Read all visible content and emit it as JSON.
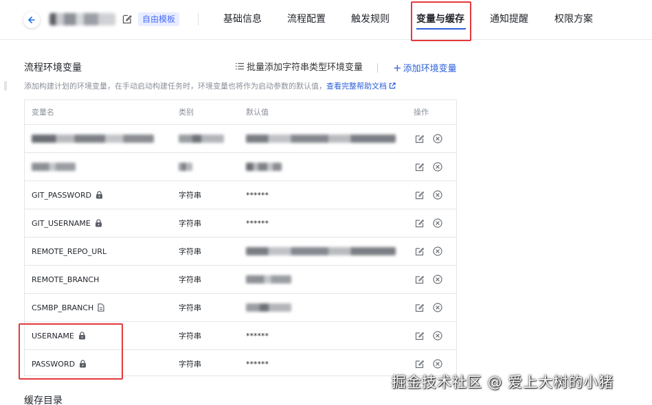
{
  "header": {
    "free_tag": "自由模板",
    "tabs": [
      "基础信息",
      "流程配置",
      "触发规则",
      "变量与缓存",
      "通知提醒",
      "权限方案"
    ],
    "active_tab": "变量与缓存"
  },
  "section": {
    "title": "流程环境变量",
    "batch_add": "批量添加字符串类型环境变量",
    "add_env": "添加环境变量",
    "desc": "添加构建计划的环境变量，在手动启动构建任务时，环境变量也将作为启动参数的默认值，",
    "help_link": "查看完整帮助文档"
  },
  "table": {
    "columns": [
      "变量名",
      "类别",
      "默认值",
      "操作"
    ],
    "rows": [
      {
        "name": "",
        "type": "",
        "default": "",
        "icon": "",
        "blurred": true
      },
      {
        "name": "",
        "type": "",
        "default": "",
        "icon": "",
        "blurred": true
      },
      {
        "name": "GIT_PASSWORD",
        "type": "字符串",
        "default": "******",
        "icon": "lock-icon"
      },
      {
        "name": "GIT_USERNAME",
        "type": "字符串",
        "default": "******",
        "icon": "lock-icon"
      },
      {
        "name": "REMOTE_REPO_URL",
        "type": "字符串",
        "default": "",
        "icon": "",
        "blurred_default": true
      },
      {
        "name": "REMOTE_BRANCH",
        "type": "字符串",
        "default": "",
        "icon": "",
        "blurred_default": true
      },
      {
        "name": "CSMBP_BRANCH",
        "type": "字符串",
        "default": "",
        "icon": "file-icon",
        "blurred_default": true
      },
      {
        "name": "USERNAME",
        "type": "字符串",
        "default": "******",
        "icon": "lock-icon"
      },
      {
        "name": "PASSWORD",
        "type": "字符串",
        "default": "******",
        "icon": "lock-icon"
      }
    ]
  },
  "cache": {
    "title": "缓存目录"
  },
  "watermark": "掘金技术社区 @ 爱上大树的小猪",
  "colors": {
    "accent": "#2b5fd9",
    "highlight": "#e2383c",
    "tag_bg": "#e8edff"
  }
}
